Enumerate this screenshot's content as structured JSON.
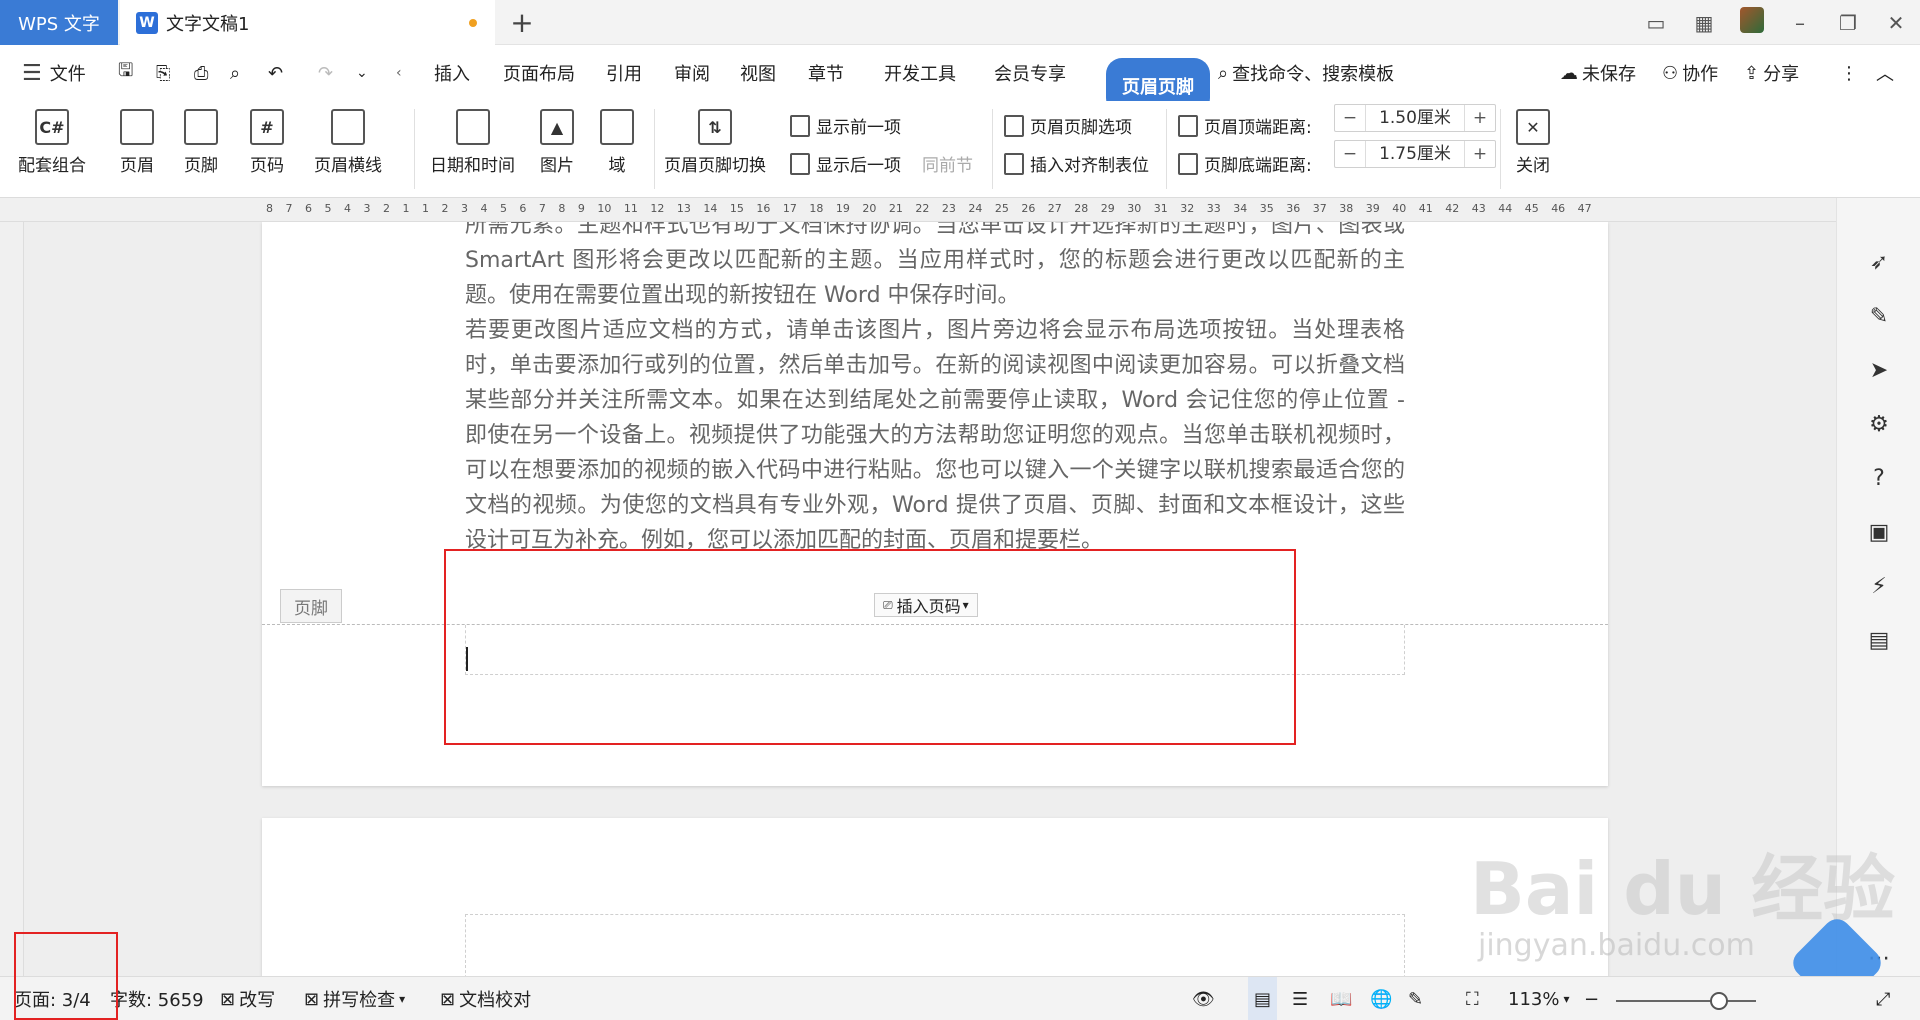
{
  "titlebar": {
    "app_tab": "WPS 文字",
    "doc_tab": "文字文稿1",
    "doc_icon": "W",
    "new_tab": "+"
  },
  "menu": {
    "file": "文件",
    "tabs": [
      "插入",
      "页面布局",
      "引用",
      "审阅",
      "视图",
      "章节",
      "开发工具",
      "会员专享"
    ],
    "active_tab": "页眉页脚",
    "search_placeholder": "查找命令、搜索模板",
    "unsaved": "未保存",
    "collaborate": "协作",
    "share": "分享"
  },
  "ribbon": {
    "combo": "配套组合",
    "header": "页眉",
    "footer": "页脚",
    "page_number": "页码",
    "header_line": "页眉横线",
    "datetime": "日期和时间",
    "picture": "图片",
    "field": "域",
    "switch": "页眉页脚切换",
    "show_prev": "显示前一项",
    "show_next": "显示后一项",
    "same_as_prev": "同前节",
    "hf_options": "页眉页脚选项",
    "insert_tab": "插入对齐制表位",
    "top_margin_label": "页眉顶端距离:",
    "top_margin_value": "1.50厘米",
    "bottom_margin_label": "页脚底端距离:",
    "bottom_margin_value": "1.75厘米",
    "close": "关闭"
  },
  "ruler": {
    "h": "8 7 6 5 4 3 2 1 1 2 3 4 5 6 7 8 9 10 11 12 13 14 15 16 17 18 19 20 21 22 23 24 25 26 27 28 29 30 31 32 33 34 35 36 37 38 39 40 41 42 43 44 45 46 47"
  },
  "document": {
    "paragraphs": [
      "所需元素。主题和样式也有助于文档保持协调。当您单击设计并选择新的主题时，图片、图表或 SmartArt 图形将会更改以匹配新的主题。当应用样式时，您的标题会进行更改以匹配新的主题。使用在需要位置出现的新按钮在 Word 中保存时间。",
      "若要更改图片适应文档的方式，请单击该图片，图片旁边将会显示布局选项按钮。当处理表格时，单击要添加行或列的位置，然后单击加号。在新的阅读视图中阅读更加容易。可以折叠文档某些部分并关注所需文本。如果在达到结尾处之前需要停止读取，Word 会记住您的停止位置 - 即使在另一个设备上。视频提供了功能强大的方法帮助您证明您的观点。当您单击联机视频时，可以在想要添加的视频的嵌入代码中进行粘贴。您也可以键入一个关键字以联机搜索最适合您的文档的视频。为使您的文档具有专业外观，Word 提供了页眉、页脚、封面和文本框设计，这些设计可互为补充。例如，您可以添加匹配的封面、页眉和提要栏。"
    ],
    "footer_label": "页脚",
    "insert_page_number": "插入页码"
  },
  "status": {
    "page": "页面: 3/4",
    "word_count": "字数: 5659",
    "revise": "改写",
    "spellcheck": "拼写检查",
    "proofread": "文档校对",
    "zoom": "113%"
  },
  "watermark": {
    "brand": "Bai du 经验",
    "url": "jingyan.baidu.com"
  },
  "colors": {
    "accent": "#3a7bd5",
    "highlight_box": "#e32222"
  }
}
